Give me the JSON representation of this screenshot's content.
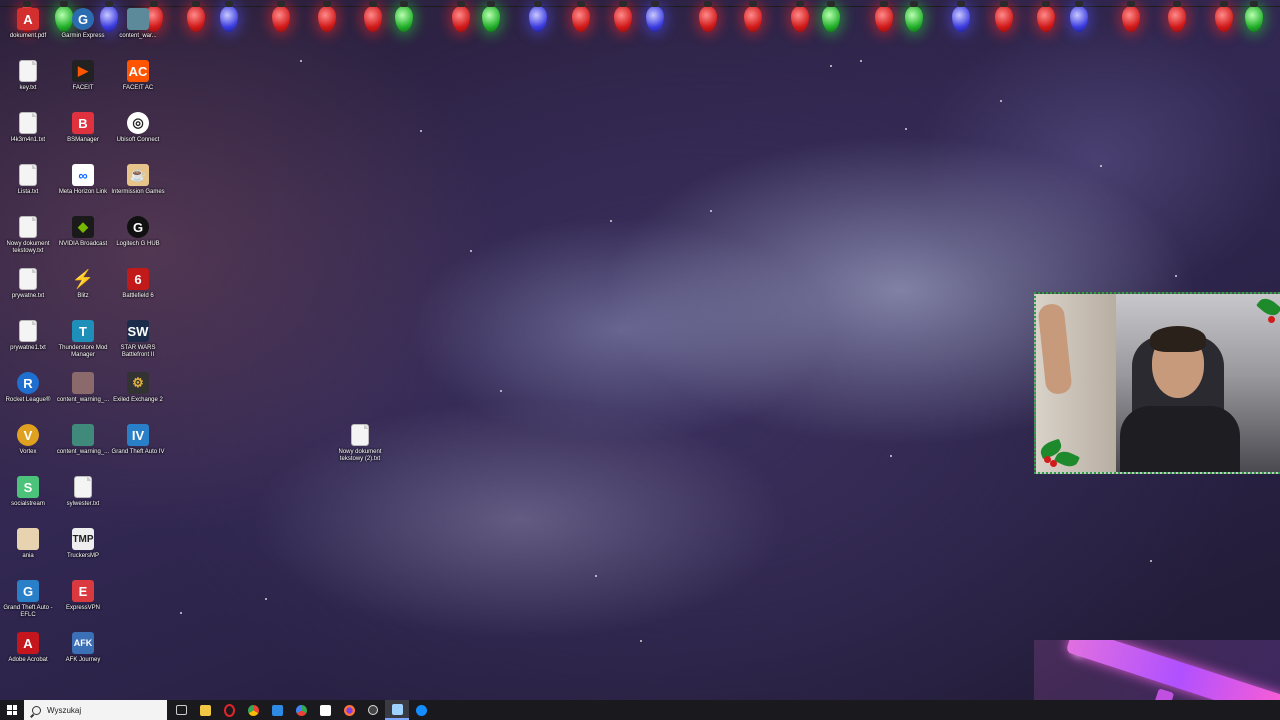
{
  "desktop_icons": {
    "col1": [
      {
        "label": "dokument.pdf",
        "icon": "pdf-file-icon"
      },
      {
        "label": "key.txt",
        "icon": "text-file-icon"
      },
      {
        "label": "l4k3m4n1.txt",
        "icon": "text-file-icon"
      },
      {
        "label": "Lista.txt",
        "icon": "text-file-icon"
      },
      {
        "label": "Nowy dokument tekstowy.txt",
        "icon": "text-file-icon"
      },
      {
        "label": "prywatne.txt",
        "icon": "text-file-icon"
      },
      {
        "label": "prywatne1.txt",
        "icon": "text-file-icon"
      },
      {
        "label": "Rocket League®",
        "icon": "rocket-league-icon"
      },
      {
        "label": "Vortex",
        "icon": "vortex-icon"
      },
      {
        "label": "socialstream",
        "icon": "socialstream-icon"
      },
      {
        "label": "ania",
        "icon": "image-file-icon"
      },
      {
        "label": "Grand Theft Auto - EFLC",
        "icon": "gta-eflc-icon"
      },
      {
        "label": "Adobe Acrobat",
        "icon": "adobe-acrobat-icon"
      }
    ],
    "col2": [
      {
        "label": "Garmin Express",
        "icon": "garmin-express-icon"
      },
      {
        "label": "FACEIT",
        "icon": "faceit-icon"
      },
      {
        "label": "BSManager",
        "icon": "bsmanager-icon"
      },
      {
        "label": "Meta Horizon Link",
        "icon": "meta-horizon-icon"
      },
      {
        "label": "NVIDIA Broadcast",
        "icon": "nvidia-broadcast-icon"
      },
      {
        "label": "Blitz",
        "icon": "blitz-icon"
      },
      {
        "label": "Thunderstore Mod Manager",
        "icon": "thunderstore-icon"
      },
      {
        "label": "content_warning_...",
        "icon": "image-file-icon"
      },
      {
        "label": "content_warning_...",
        "icon": "image-file-icon"
      },
      {
        "label": "sylwester.txt",
        "icon": "text-file-icon"
      },
      {
        "label": "TruckersMP",
        "icon": "truckersmp-icon"
      },
      {
        "label": "ExpressVPN",
        "icon": "expressvpn-icon"
      },
      {
        "label": "AFK Journey",
        "icon": "afk-journey-icon"
      }
    ],
    "col3": [
      {
        "label": "content_war...",
        "icon": "image-file-icon"
      },
      {
        "label": "FACEIT AC",
        "icon": "faceit-ac-icon"
      },
      {
        "label": "Ubisoft Connect",
        "icon": "ubisoft-connect-icon"
      },
      {
        "label": "Intermission Games",
        "icon": "intermission-games-icon"
      },
      {
        "label": "Logitech G HUB",
        "icon": "logitech-ghub-icon"
      },
      {
        "label": "Battlefield 6",
        "icon": "battlefield-icon"
      },
      {
        "label": "STAR WARS Battlefront II",
        "icon": "battlefront-icon"
      },
      {
        "label": "Exiled Exchange 2",
        "icon": "exiled-exchange-icon"
      },
      {
        "label": "Grand Theft Auto IV",
        "icon": "gta-iv-icon"
      }
    ],
    "loose": {
      "label": "Nowy dokument tekstowy (2).txt",
      "icon": "text-file-icon"
    }
  },
  "taskbar": {
    "search_placeholder": "Wyszukaj",
    "apps": [
      {
        "name": "task-view-icon",
        "color": "#cccccc"
      },
      {
        "name": "file-explorer-icon",
        "color": "#f2c744"
      },
      {
        "name": "opera-icon",
        "color": "#e0242b"
      },
      {
        "name": "chrome-icon",
        "color": "#4285f4"
      },
      {
        "name": "microsoft-store-icon",
        "color": "#2f8ae4"
      },
      {
        "name": "chrome-alt-icon",
        "color": "#34a853"
      },
      {
        "name": "notion-icon",
        "color": "#ffffff"
      },
      {
        "name": "firefox-icon",
        "color": "#ff7139"
      },
      {
        "name": "obs-icon",
        "color": "#444444"
      },
      {
        "name": "notepad-icon",
        "color": "#9fd3ff"
      },
      {
        "name": "battlenet-icon",
        "color": "#148eff"
      }
    ]
  },
  "colors": {
    "accent": "#7aa7ff",
    "webcam_border": "#2ea043"
  }
}
